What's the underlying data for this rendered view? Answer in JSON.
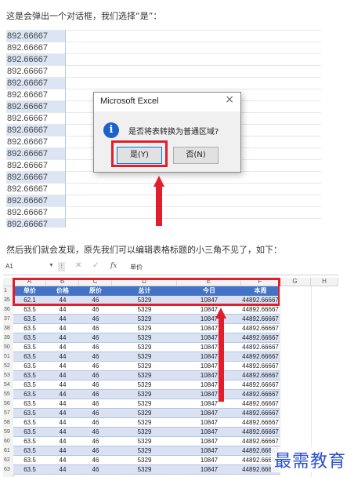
{
  "captions": {
    "p1": "这是会弹出一个对话框，我们选择“是”：",
    "p2": "然后我们就会发现，原先我们可以编辑表格标题的小三角不见了，如下："
  },
  "section1": {
    "cell_value": "892.66667",
    "row_count": 17
  },
  "dialog": {
    "title": "Microsoft Excel",
    "close_glyph": "×",
    "icon_glyph": "i",
    "message": "是否将表转换为普通区域?",
    "yes_label": "是(Y)",
    "no_label": "否(N)"
  },
  "excel": {
    "namebox": "A1",
    "namebox_arrow": "▼",
    "dots": "⋮",
    "cancel_glyph": "✕",
    "check_glyph": "✓",
    "fx": "fx",
    "formula_value": "单价",
    "columns": [
      "A",
      "B",
      "C",
      "D",
      "E",
      "F",
      "G",
      "H"
    ],
    "row_numbers": [
      "1",
      "35",
      "36",
      "37",
      "38",
      "39",
      "50",
      "51",
      "52",
      "53",
      "54",
      "55",
      "56",
      "57",
      "58",
      "59",
      "60",
      "61",
      "62",
      "63"
    ],
    "headers": [
      "单价",
      "价格",
      "原价",
      "总计",
      "今日",
      "本周"
    ],
    "first_row": [
      "62.1",
      "44",
      "46",
      "5329",
      "10847",
      "44892.66667"
    ],
    "data_row": [
      "63.5",
      "44",
      "46",
      "5329",
      "10847",
      "44892.66667"
    ],
    "data_row_count": 18
  },
  "watermark": "最需教育",
  "colors": {
    "accent_red": "#e01e2c",
    "table_header_blue": "#4472c4",
    "band_blue": "#d9e1f2",
    "info_icon_blue": "#1c63c7"
  }
}
